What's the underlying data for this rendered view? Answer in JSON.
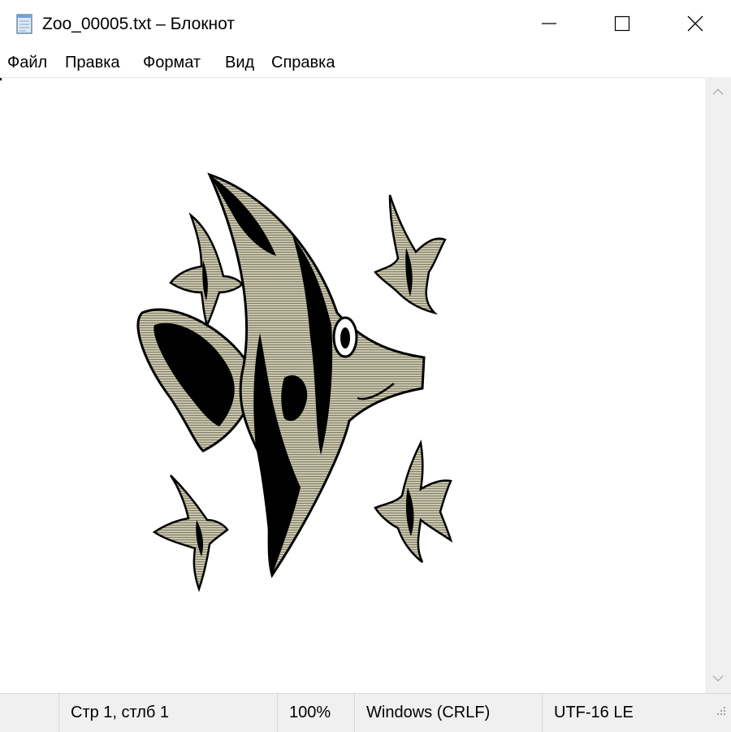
{
  "window": {
    "title": "Zoo_00005.txt – Блокнот",
    "app_icon": "notepad-icon",
    "controls": [
      "minimize-icon",
      "maximize-icon",
      "close-icon"
    ]
  },
  "menu": {
    "items": [
      "Файл",
      "Правка",
      "Формат",
      "Вид",
      "Справка"
    ]
  },
  "document": {
    "content_description_icon": "angelfish-ascii-art"
  },
  "status": {
    "position": "Стр 1, стлб 1",
    "zoom": "100%",
    "line_endings": "Windows (CRLF)",
    "encoding": "UTF-16 LE"
  },
  "colors": {
    "fish_body": "#c9c6ac",
    "fish_stripe": "#000000",
    "status_bg": "#f0f0f0",
    "scrollbar_bg": "#f0f0f0"
  }
}
